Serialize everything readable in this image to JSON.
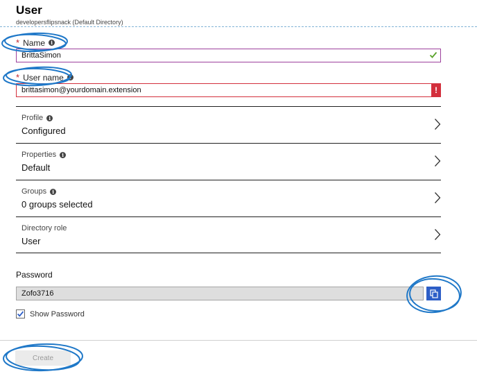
{
  "header": {
    "title": "User",
    "subtitle": "developersflipsnack (Default Directory)"
  },
  "form": {
    "name": {
      "label": "Name",
      "value": "BrittaSimon",
      "required_mark": "*"
    },
    "username": {
      "label": "User name",
      "value": "brittasimon@yourdomain.extension",
      "required_mark": "*",
      "error_mark": "!"
    },
    "rows": [
      {
        "label": "Profile",
        "value": "Configured"
      },
      {
        "label": "Properties",
        "value": "Default"
      },
      {
        "label": "Groups",
        "value": "0 groups selected"
      },
      {
        "label": "Directory role",
        "value": "User"
      }
    ],
    "password": {
      "label": "Password",
      "value": "Zofo3716"
    },
    "show_password": {
      "label": "Show Password",
      "checked": true
    },
    "create_label": "Create"
  },
  "icons": {
    "info": "info-icon",
    "check": "checkmark-icon",
    "error": "error-icon",
    "chevron": "chevron-right-icon",
    "copy": "copy-icon"
  },
  "colors": {
    "name_border": "#9c3f9c",
    "error": "#d32f3c",
    "valid_check": "#5aa32b",
    "copy_button": "#2d5ec7",
    "annotation": "#1f78c8"
  }
}
